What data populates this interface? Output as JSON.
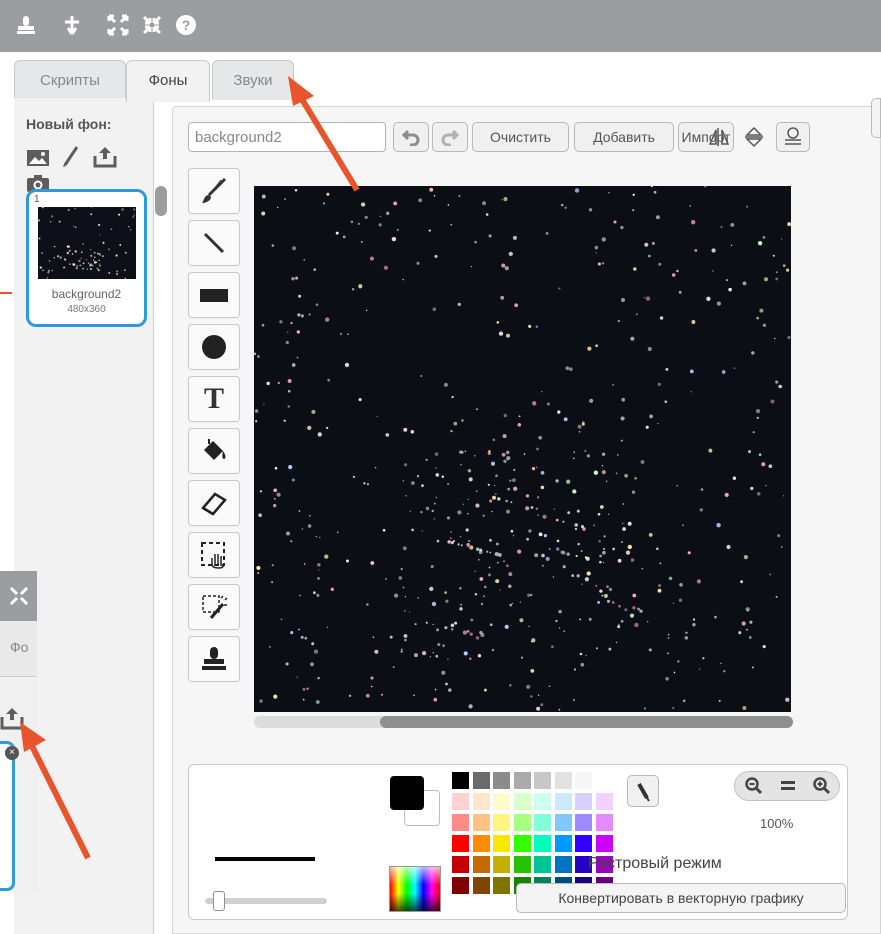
{
  "toolbar": {
    "icons": [
      "stamp-icon",
      "grow-sprite-icon",
      "expand-icon",
      "shrink-icon",
      "help-icon"
    ]
  },
  "tabs": [
    {
      "label": "Скрипты",
      "active": false
    },
    {
      "label": "Фоны",
      "active": true
    },
    {
      "label": "Звуки",
      "active": false
    }
  ],
  "left_panel": {
    "new_backdrop_label": "Новый фон:",
    "new_backdrop_icons": [
      "choose-from-library-icon",
      "paint-new-icon",
      "upload-icon",
      "camera-icon"
    ],
    "costume": {
      "number": "1",
      "name": "background2",
      "size": "480x360"
    }
  },
  "editor": {
    "name_field_value": "background2",
    "undo_label": "↶",
    "redo_label": "↷",
    "clear_label": "Очистить",
    "add_label": "Добавить",
    "import_label": "Импорт",
    "tools": [
      "brush-tool",
      "line-tool",
      "rectangle-tool",
      "ellipse-tool",
      "text-tool",
      "fill-tool",
      "eraser-tool",
      "select-tool",
      "remove-background-tool",
      "stamp-tool"
    ],
    "zoom_percent": "100%",
    "mode_label": "Растровый режим",
    "convert_tooltip": "Конвертировать в векторную графику"
  },
  "fragment": {
    "tab_label": "Фо"
  },
  "colors": {
    "accent_blue": "#2d9bd9",
    "toolbar_gray": "#9b9da0",
    "arrow_red": "#e8542b"
  }
}
